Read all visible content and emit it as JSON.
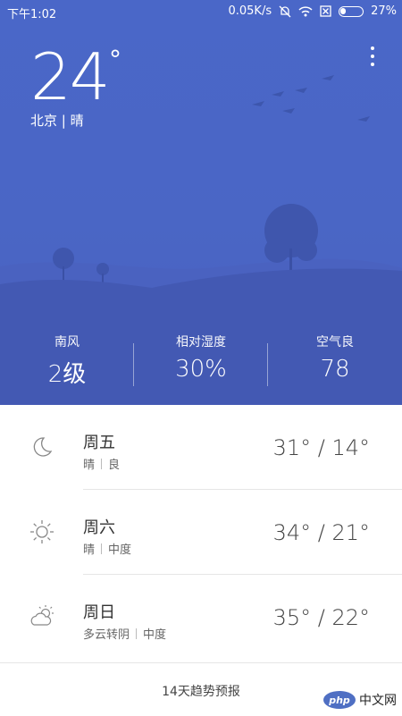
{
  "status_bar": {
    "time": "下午1:02",
    "network_speed": "0.05K/s",
    "battery_percent": "27%",
    "battery_level": 0.27,
    "icons": [
      "mute-bell-icon",
      "wifi-icon",
      "no-sim-icon",
      "battery-icon"
    ]
  },
  "current": {
    "temperature": "24",
    "degree_symbol": "°",
    "city": "北京",
    "condition": "晴"
  },
  "stats": [
    {
      "label": "南风",
      "value": "2级"
    },
    {
      "label": "相对湿度",
      "value": "30%"
    },
    {
      "label": "空气良",
      "value": "78"
    }
  ],
  "forecast": [
    {
      "icon": "moon-icon",
      "day": "周五",
      "weather": "晴",
      "air": "良",
      "temps": "31° / 14°"
    },
    {
      "icon": "sun-icon",
      "day": "周六",
      "weather": "晴",
      "air": "中度",
      "temps": "34° / 21°"
    },
    {
      "icon": "partly-cloudy-icon",
      "day": "周日",
      "weather": "多云转阴",
      "air": "中度",
      "temps": "35° / 22°"
    }
  ],
  "trend_link": "14天趋势预报",
  "watermark": {
    "badge": "php",
    "text": "中文网"
  },
  "colors": {
    "hero_bg": "#4a66c5",
    "hills": "#4359b3",
    "watermark": "#4f6fc3"
  }
}
